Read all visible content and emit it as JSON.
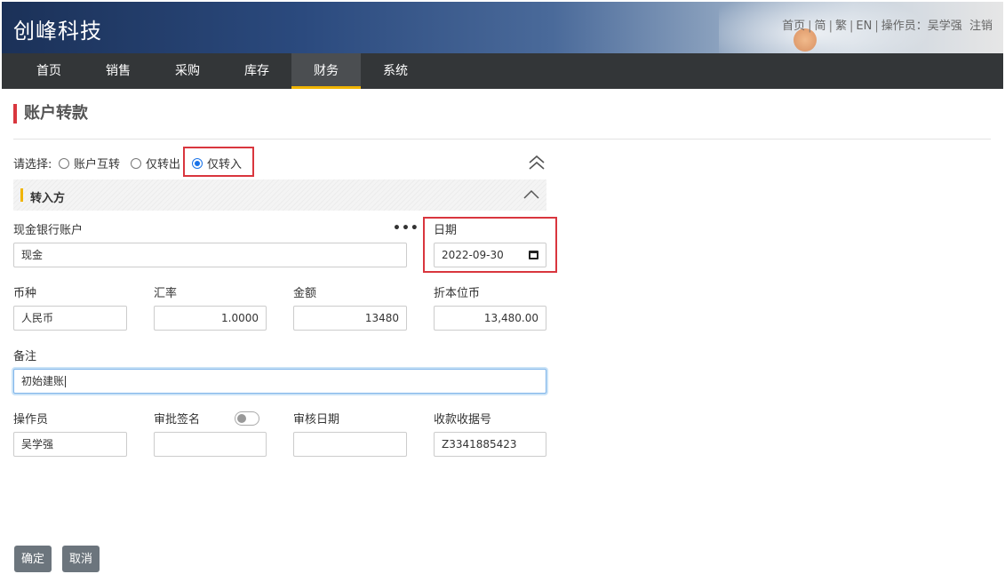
{
  "header": {
    "brand": "创峰科技",
    "links": [
      "首页",
      "简",
      "繁",
      "EN"
    ],
    "operator_label": "操作员：吴学强",
    "logout": "注销"
  },
  "nav": {
    "items": [
      "首页",
      "销售",
      "采购",
      "库存",
      "财务",
      "系统"
    ],
    "active": "财务"
  },
  "page": {
    "title": "账户转款"
  },
  "choose": {
    "label": "请选择:",
    "options": [
      "账户互转",
      "仅转出",
      "仅转入"
    ],
    "selected": "仅转入"
  },
  "section": {
    "title": "转入方"
  },
  "form": {
    "account": {
      "label": "现金银行账户",
      "value": "现金"
    },
    "date": {
      "label": "日期",
      "value": "2022-09-30"
    },
    "currency": {
      "label": "币种",
      "value": "人民币"
    },
    "rate": {
      "label": "汇率",
      "value": "1.0000"
    },
    "amount": {
      "label": "金额",
      "value": "13480"
    },
    "base_amount": {
      "label": "折本位币",
      "value": "13,480.00"
    },
    "remark": {
      "label": "备注",
      "value": "初始建账"
    },
    "operator": {
      "label": "操作员",
      "value": "吴学强"
    },
    "approval_sign": {
      "label": "审批签名",
      "value": ""
    },
    "review_date": {
      "label": "审核日期",
      "value": ""
    },
    "receipt_no": {
      "label": "收款收据号",
      "value": "Z3341885423"
    }
  },
  "buttons": {
    "confirm": "确定",
    "cancel": "取消"
  },
  "colors": {
    "accent": "#d9363e",
    "nav_bg": "#333638",
    "active_underline": "#f0b400",
    "radio": "#1a73e8",
    "button": "#6c757d"
  }
}
